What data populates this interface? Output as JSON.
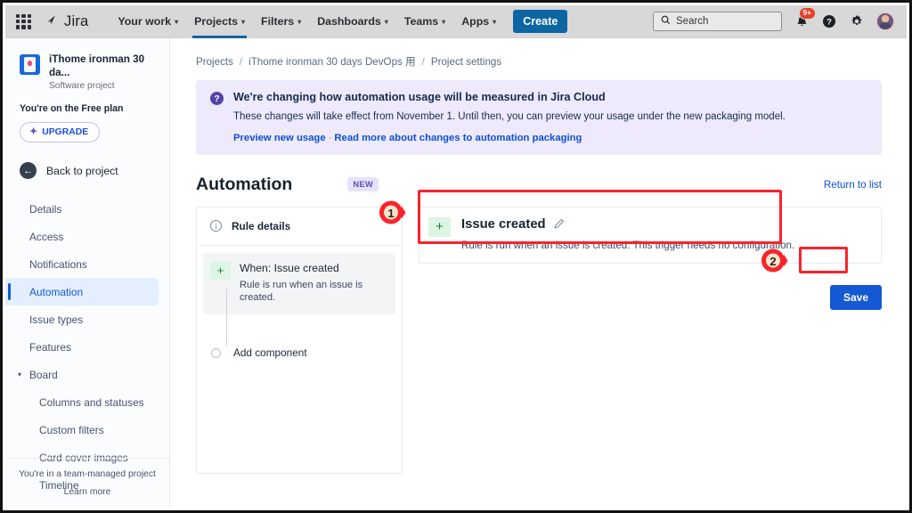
{
  "topnav": {
    "app_switcher": "app-switcher",
    "brand": "Jira",
    "items": [
      {
        "label": "Your work",
        "has_caret": true,
        "active": false
      },
      {
        "label": "Projects",
        "has_caret": true,
        "active": true
      },
      {
        "label": "Filters",
        "has_caret": true,
        "active": false
      },
      {
        "label": "Dashboards",
        "has_caret": true,
        "active": false
      },
      {
        "label": "Teams",
        "has_caret": true,
        "active": false
      },
      {
        "label": "Apps",
        "has_caret": true,
        "active": false
      }
    ],
    "create_label": "Create",
    "search_placeholder": "Search",
    "notification_badge": "9+",
    "icons": [
      "search-icon",
      "notifications-bell-icon",
      "help-icon",
      "settings-gear-icon",
      "user-avatar"
    ]
  },
  "sidebar": {
    "project_name": "iThome ironman 30 da...",
    "project_type": "Software project",
    "plan_text": "You're on the Free plan",
    "upgrade_label": "UPGRADE",
    "back_label": "Back to project",
    "items": [
      {
        "label": "Details",
        "selected": false,
        "sub": false
      },
      {
        "label": "Access",
        "selected": false,
        "sub": false
      },
      {
        "label": "Notifications",
        "selected": false,
        "sub": false
      },
      {
        "label": "Automation",
        "selected": true,
        "sub": false
      },
      {
        "label": "Issue types",
        "selected": false,
        "sub": false
      },
      {
        "label": "Features",
        "selected": false,
        "sub": false
      },
      {
        "label": "Board",
        "selected": false,
        "sub": false,
        "expandable": true
      },
      {
        "label": "Columns and statuses",
        "selected": false,
        "sub": true
      },
      {
        "label": "Custom filters",
        "selected": false,
        "sub": true
      },
      {
        "label": "Card cover images",
        "selected": false,
        "sub": true
      },
      {
        "label": "Timeline",
        "selected": false,
        "sub": true
      }
    ],
    "footer_text": "You're in a team-managed project",
    "footer_link": "Learn more"
  },
  "breadcrumb": {
    "projects": "Projects",
    "project": "iThome ironman 30 days DevOps 用",
    "settings": "Project settings",
    "separator": "/"
  },
  "banner": {
    "icon": "question-circle-icon",
    "title": "We're changing how automation usage will be measured in Jira Cloud",
    "body": "These changes will take effect from November 1. Until then, you can preview your usage under the new packaging model.",
    "link1": "Preview new usage",
    "link_separator": "·",
    "link2": "Read more about changes to automation packaging"
  },
  "page": {
    "title": "Automation",
    "badge": "NEW",
    "return_link": "Return to list"
  },
  "rule_panel": {
    "details_label": "Rule details",
    "details_icon": "info-circle-icon",
    "trigger_title": "When: Issue created",
    "trigger_desc": "Rule is run when an issue is created.",
    "trigger_plus": "+",
    "add_component_label": "Add component"
  },
  "detail_panel": {
    "plus": "+",
    "title": "Issue created",
    "edit_icon": "pencil-edit-icon",
    "description": "Rule is run when an issue is created. This trigger needs no configuration.",
    "save_label": "Save"
  },
  "annotations": [
    {
      "number": "1",
      "target": "issue-created-trigger-detail"
    },
    {
      "number": "2",
      "target": "save-button"
    }
  ],
  "colors": {
    "jira_blue": "#0c66a4",
    "primary_blue": "#1558d4",
    "link_blue": "#0c4fd6",
    "selected_bg": "#e3efff",
    "banner_bg": "#eeeafc",
    "badge_purple": "#5e4db2",
    "green_plus_bg": "#dcf5e4",
    "annotation_red": "#f8232c",
    "notification_red": "#e8402a"
  }
}
